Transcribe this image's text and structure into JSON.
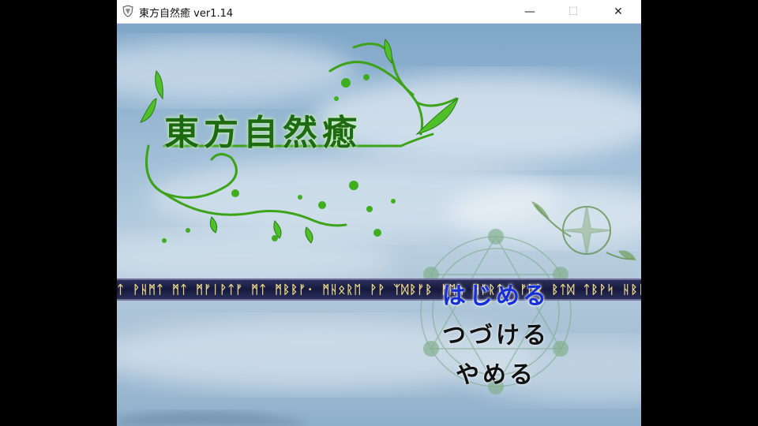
{
  "window": {
    "title": "東方自然癒 ver1.14",
    "min_glyph": "—",
    "max_glyph": "☐",
    "close_glyph": "✕",
    "icon": "app-shield-icon"
  },
  "game": {
    "logo_title": "東方自然癒",
    "rune_band_text": "ᛏ ᚹᚺᛗᛏ ᛗᛏ ᛗᚠᛁᚹᛏᚠ ᛗᛏ ᛗᛒᛒᚠ·   ᛗᚺᛟᚱᛖ ᚹᚹ ᛉᛞᛒᚠᛒ ᚠᛖᚢ ᛗᚠᚱᛏ·   ᚠᚢᚱ ᛒᛏᛞ ᛏᛒᚹᛋ ᚺᛒᚠ· ᛗᚱᛖ",
    "menu": {
      "start": "はじめる",
      "continue": "つづける",
      "quit": "やめる"
    },
    "colors": {
      "logo": "#1d6a12",
      "selected_menu": "#1430d6",
      "menu": "#111111",
      "rune_band": "#171a3e",
      "rune_glyphs": "#e6d38a"
    }
  }
}
